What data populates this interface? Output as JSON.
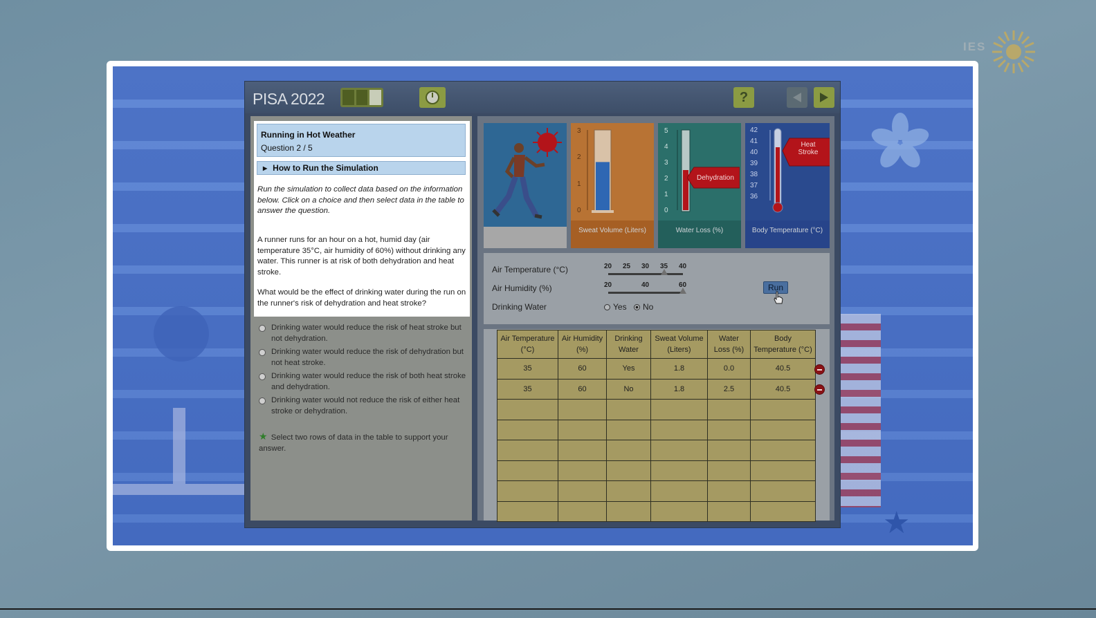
{
  "ies_logo": {
    "text": "IES"
  },
  "header": {
    "title": "PISA 2022",
    "help_label": "?"
  },
  "question": {
    "title": "Running in Hot Weather",
    "number": "Question 2 / 5",
    "howto_label": "How to Run the Simulation",
    "intro": "Run the simulation to collect data based on the information below. Click on a choice and then select data in the table to answer the question.",
    "scenario": "A runner runs for an hour on a hot, humid day (air temperature 35°C, air humidity of 60%) without drinking any water. This runner is at risk of both dehydration and heat stroke.",
    "ask": "What would be the effect of drinking water during the run on the runner's risk of dehydration and heat stroke?"
  },
  "options": [
    "Drinking water would reduce the risk of heat stroke but not dehydration.",
    "Drinking water would reduce the risk of dehydration but not heat stroke.",
    "Drinking water would reduce the risk of both heat stroke and dehydration.",
    "Drinking water would not reduce the risk of either heat stroke or dehydration."
  ],
  "support_text": "Select two rows of data in the table to support your answer.",
  "gauges": {
    "sweat": {
      "label": "Sweat Volume (Liters)",
      "ticks": [
        "3",
        "2",
        "1",
        "0"
      ],
      "level": 1.8,
      "max": 3
    },
    "water": {
      "label": "Water Loss (%)",
      "ticks": [
        "5",
        "4",
        "3",
        "2",
        "1",
        "0"
      ],
      "level": 2.5,
      "max": 5,
      "tag": "Dehydration"
    },
    "temp": {
      "label": "Body Temperature (°C)",
      "ticks": [
        "42",
        "41",
        "40",
        "39",
        "38",
        "37",
        "36"
      ],
      "level": 40.5,
      "tag": "Heat Stroke"
    }
  },
  "controls": {
    "air_temp": {
      "label": "Air Temperature (°C)",
      "ticks": [
        "20",
        "25",
        "30",
        "35",
        "40"
      ],
      "selected": "35"
    },
    "air_humidity": {
      "label": "Air Humidity (%)",
      "ticks": [
        "20",
        "40",
        "60"
      ],
      "selected": "60"
    },
    "drinking_water": {
      "label": "Drinking Water",
      "yes": "Yes",
      "no": "No",
      "selected": "No"
    },
    "run_label": "Run"
  },
  "table": {
    "headers": [
      "Air Temperature (°C)",
      "Air Humidity (%)",
      "Drinking Water",
      "Sweat Volume (Liters)",
      "Water Loss (%)",
      "Body Temperature (°C)"
    ],
    "rows": [
      [
        "35",
        "60",
        "Yes",
        "1.8",
        "0.0",
        "40.5"
      ],
      [
        "35",
        "60",
        "No",
        "1.8",
        "2.5",
        "40.5"
      ],
      [
        "",
        "",
        "",
        "",
        "",
        ""
      ],
      [
        "",
        "",
        "",
        "",
        "",
        ""
      ],
      [
        "",
        "",
        "",
        "",
        "",
        ""
      ],
      [
        "",
        "",
        "",
        "",
        "",
        ""
      ],
      [
        "",
        "",
        "",
        "",
        "",
        ""
      ],
      [
        "",
        "",
        "",
        "",
        "",
        ""
      ]
    ]
  },
  "colors": {
    "header_accent": "#8b9b43",
    "question_header": "#b9d4ec",
    "table_cell": "#a59a62",
    "alert_red": "#b3141a"
  }
}
